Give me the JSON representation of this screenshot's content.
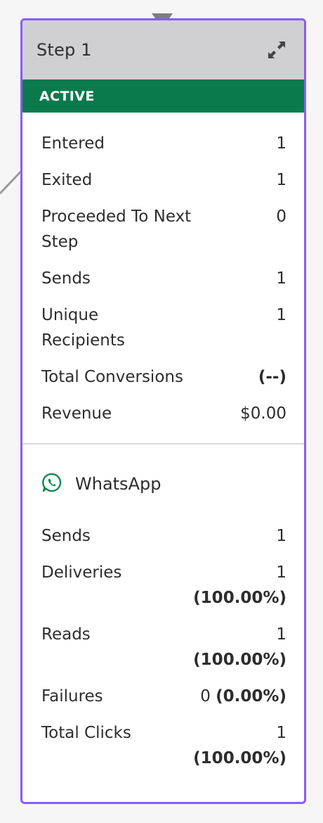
{
  "step": {
    "title": "Step 1",
    "status": "ACTIVE"
  },
  "stats": [
    {
      "label": "Entered",
      "value": "1"
    },
    {
      "label": "Exited",
      "value": "1"
    },
    {
      "label": "Proceeded To Next Step",
      "value": "0"
    },
    {
      "label": "Sends",
      "value": "1"
    },
    {
      "label": "Unique Recipients",
      "value": "1"
    },
    {
      "label": "Total Conversions",
      "value": "(--)"
    },
    {
      "label": "Revenue",
      "value": "$0.00"
    }
  ],
  "channel": {
    "name": "WhatsApp",
    "icon": "whatsapp-icon",
    "stats": [
      {
        "label": "Sends",
        "value": "1",
        "pct": ""
      },
      {
        "label": "Deliveries",
        "value": "1",
        "pct": "(100.00%)"
      },
      {
        "label": "Reads",
        "value": "1",
        "pct": "(100.00%)"
      },
      {
        "label": "Failures",
        "value": "0",
        "pct": "(0.00%)"
      },
      {
        "label": "Total Clicks",
        "value": "1",
        "pct": "(100.00%)"
      }
    ]
  },
  "colors": {
    "border": "#8b5cf6",
    "header_bg": "#d0d0d3",
    "status_bg": "#0a7a4c",
    "whatsapp": "#128c4b",
    "connector": "#9a9a9a"
  }
}
